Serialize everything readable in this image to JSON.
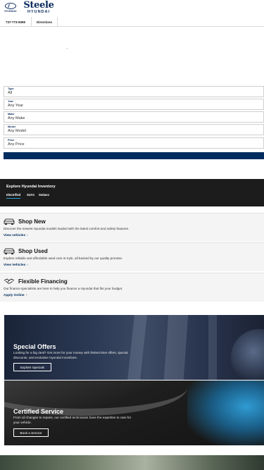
{
  "header": {
    "brand_logo_text": "HYUNDAI",
    "dealer_name": "Steele",
    "dealer_sub": "HYUNDAI"
  },
  "linkbar": {
    "phone": "737-773-5065",
    "directions": "Directions"
  },
  "filters": [
    {
      "label": "Type",
      "value": "All"
    },
    {
      "label": "Year",
      "value": "Any Year"
    },
    {
      "label": "Make",
      "value": "Any Make"
    },
    {
      "label": "Model",
      "value": "Any Model"
    },
    {
      "label": "Price",
      "value": "Any Price"
    }
  ],
  "explore": {
    "title": "Explore Hyundai Inventory",
    "tabs": [
      "Electrified",
      "SUVs",
      "Sedans"
    ]
  },
  "cards": [
    {
      "icon": "car-icon",
      "title": "Shop New",
      "description": "Discover the newest Hyundai models loaded with the latest comfort and safety features.",
      "link": "View vehicles"
    },
    {
      "icon": "car-icon",
      "title": "Shop Used",
      "description": "Explore reliable and affordable used cars in Kyle, all backed by our quality promise.",
      "link": "View Vehicles"
    },
    {
      "icon": "handshake-icon",
      "title": "Flexible Financing",
      "description": "Our finance specialists are here to help you finance a Hyundai that fits your budget.",
      "link": "Apply Online"
    }
  ],
  "promos": {
    "offers": {
      "title": "Special Offers",
      "description": "Looking for a big deal? Get more for your money with limited-time offers, special discounts, and exclusive Hyundai incentives.",
      "button": "Explore Specials"
    },
    "service": {
      "title": "Certified Service",
      "description": "From oil changes to repairs, our certified technicians have the expertise to care for your vehicle.",
      "button": "Book a Service"
    }
  },
  "colors": {
    "brand_navy": "#002c5f",
    "explore_bg": "#1c1c1c",
    "tab_underline": "#2aa0d8"
  }
}
